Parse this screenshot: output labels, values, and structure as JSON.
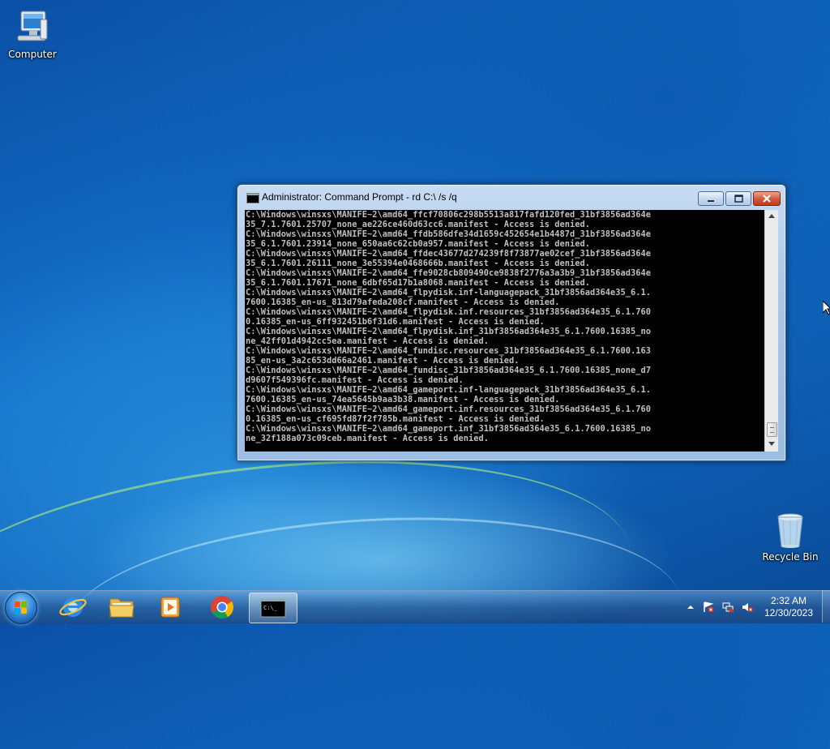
{
  "desktop": {
    "icons": [
      {
        "label": "Computer"
      },
      {
        "label": "Recycle Bin"
      }
    ]
  },
  "window": {
    "title": "Administrator: Command Prompt - rd  C:\\ /s /q",
    "console_text": "C:\\Windows\\winsxs\\MANIFE~2\\amd64_ffcf70806c298b5513a817fafd120fed_31bf3856ad364e\n35_7.1.7601.25707_none_ae226ce460d63cc6.manifest - Access is denied.\nC:\\Windows\\winsxs\\MANIFE~2\\amd64_ffdb586dfe34d1659c452654e1b4487d_31bf3856ad364e\n35_6.1.7601.23914_none_650aa6c62cb0a957.manifest - Access is denied.\nC:\\Windows\\winsxs\\MANIFE~2\\amd64_ffdec43677d274239f8f73877ae02cef_31bf3856ad364e\n35_6.1.7601.26111_none_3e55394e0468666b.manifest - Access is denied.\nC:\\Windows\\winsxs\\MANIFE~2\\amd64_ffe9028cb809490ce9838f2776a3a3b9_31bf3856ad364e\n35_6.1.7601.17671_none_6dbf65d17b1a8068.manifest - Access is denied.\nC:\\Windows\\winsxs\\MANIFE~2\\amd64_flpydisk.inf-languagepack_31bf3856ad364e35_6.1.\n7600.16385_en-us_813d79afeda208cf.manifest - Access is denied.\nC:\\Windows\\winsxs\\MANIFE~2\\amd64_flpydisk.inf.resources_31bf3856ad364e35_6.1.760\n0.16385_en-us_6ff932451b6f31d6.manifest - Access is denied.\nC:\\Windows\\winsxs\\MANIFE~2\\amd64_flpydisk.inf_31bf3856ad364e35_6.1.7600.16385_no\nne_42ff01d4942cc5ea.manifest - Access is denied.\nC:\\Windows\\winsxs\\MANIFE~2\\amd64_fundisc.resources_31bf3856ad364e35_6.1.7600.163\n85_en-us_3a2c653dd66a2461.manifest - Access is denied.\nC:\\Windows\\winsxs\\MANIFE~2\\amd64_fundisc_31bf3856ad364e35_6.1.7600.16385_none_d7\nd9607f549396fc.manifest - Access is denied.\nC:\\Windows\\winsxs\\MANIFE~2\\amd64_gameport.inf-languagepack_31bf3856ad364e35_6.1.\n7600.16385_en-us_74ea5645b9aa3b38.manifest - Access is denied.\nC:\\Windows\\winsxs\\MANIFE~2\\amd64_gameport.inf.resources_31bf3856ad364e35_6.1.760\n0.16385_en-us_cf695fd87f2f785b.manifest - Access is denied.\nC:\\Windows\\winsxs\\MANIFE~2\\amd64_gameport.inf_31bf3856ad364e35_6.1.7600.16385_no\nne_32f188a073c09ceb.manifest - Access is denied."
  },
  "taskbar": {
    "apps": [
      {
        "icon": "internet-explorer-icon"
      },
      {
        "icon": "folder-icon"
      },
      {
        "icon": "media-player-icon"
      },
      {
        "icon": "chrome-icon"
      },
      {
        "icon": "command-prompt-icon",
        "active": true
      }
    ],
    "clock_time": "2:32 AM",
    "clock_date": "12/30/2023"
  },
  "colors": {
    "console_bg": "#000000",
    "console_fg": "#c0c0c0",
    "close_button": "#c8462a"
  }
}
